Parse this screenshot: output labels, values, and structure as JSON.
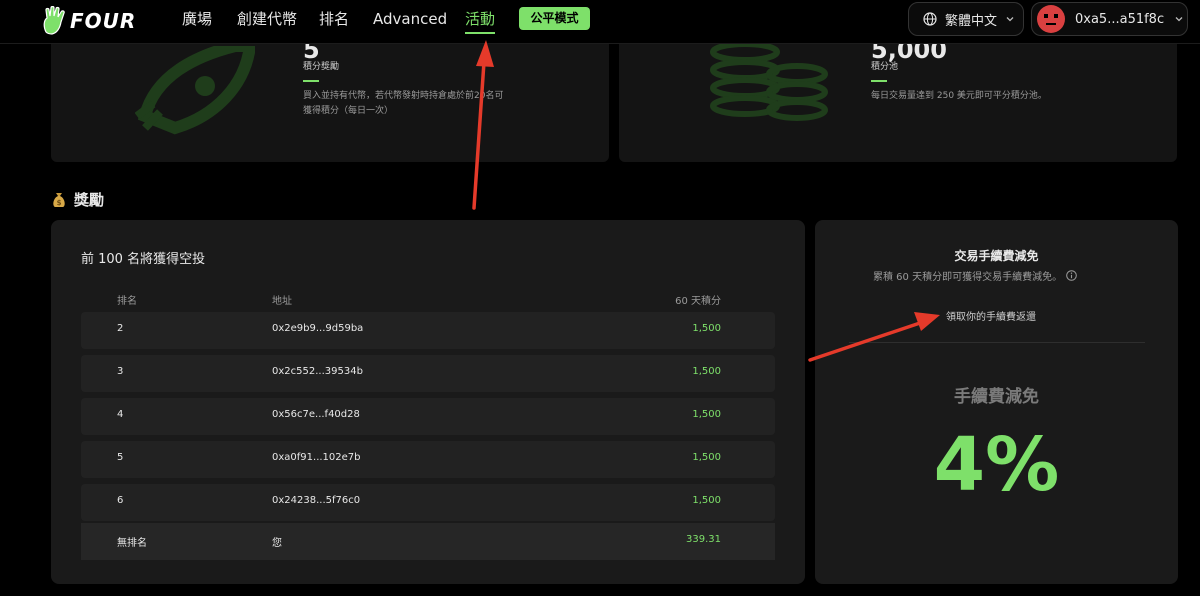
{
  "nav": {
    "logo_text": "FOUR",
    "items": [
      "廣場",
      "創建代幣",
      "排名",
      "Advanced",
      "活動"
    ],
    "active_index": 4,
    "fair_mode_label": "公平模式",
    "language": "繁體中文",
    "wallet": "0xa5...a51f8c"
  },
  "top_cards": {
    "left": {
      "value": "5",
      "label": "積分獎勵",
      "desc_line1": "買入並持有代幣，若代幣發射時持倉處於前20名可",
      "desc_line2": "獲得積分（每日一次）"
    },
    "right": {
      "value": "5,000",
      "label": "積分池",
      "desc": "每日交易量達到 250 美元即可平分積分池。"
    }
  },
  "rewards": {
    "title": "獎勵",
    "airdrop": {
      "title": "前 100 名將獲得空投",
      "headers": {
        "rank": "排名",
        "address": "地址",
        "points": "60 天積分"
      },
      "rows": [
        {
          "rank": "2",
          "address": "0x2e9b9...9d59ba",
          "points": "1,500"
        },
        {
          "rank": "3",
          "address": "0x2c552...39534b",
          "points": "1,500"
        },
        {
          "rank": "4",
          "address": "0x56c7e...f40d28",
          "points": "1,500"
        },
        {
          "rank": "5",
          "address": "0xa0f91...102e7b",
          "points": "1,500"
        },
        {
          "rank": "6",
          "address": "0x24238...5f76c0",
          "points": "1,500"
        }
      ],
      "you_row": {
        "rank": "無排名",
        "address": "您",
        "points": "339.31"
      }
    },
    "fee": {
      "title": "交易手續費減免",
      "subtitle": "累積 60 天積分即可獲得交易手續費減免。",
      "link": "領取你的手續費返還",
      "label": "手續費減免",
      "value": "4%"
    }
  },
  "colors": {
    "accent": "#7ee06a",
    "arrow": "#e53a2a",
    "panel": "#1a1a1a",
    "background": "#000000"
  }
}
